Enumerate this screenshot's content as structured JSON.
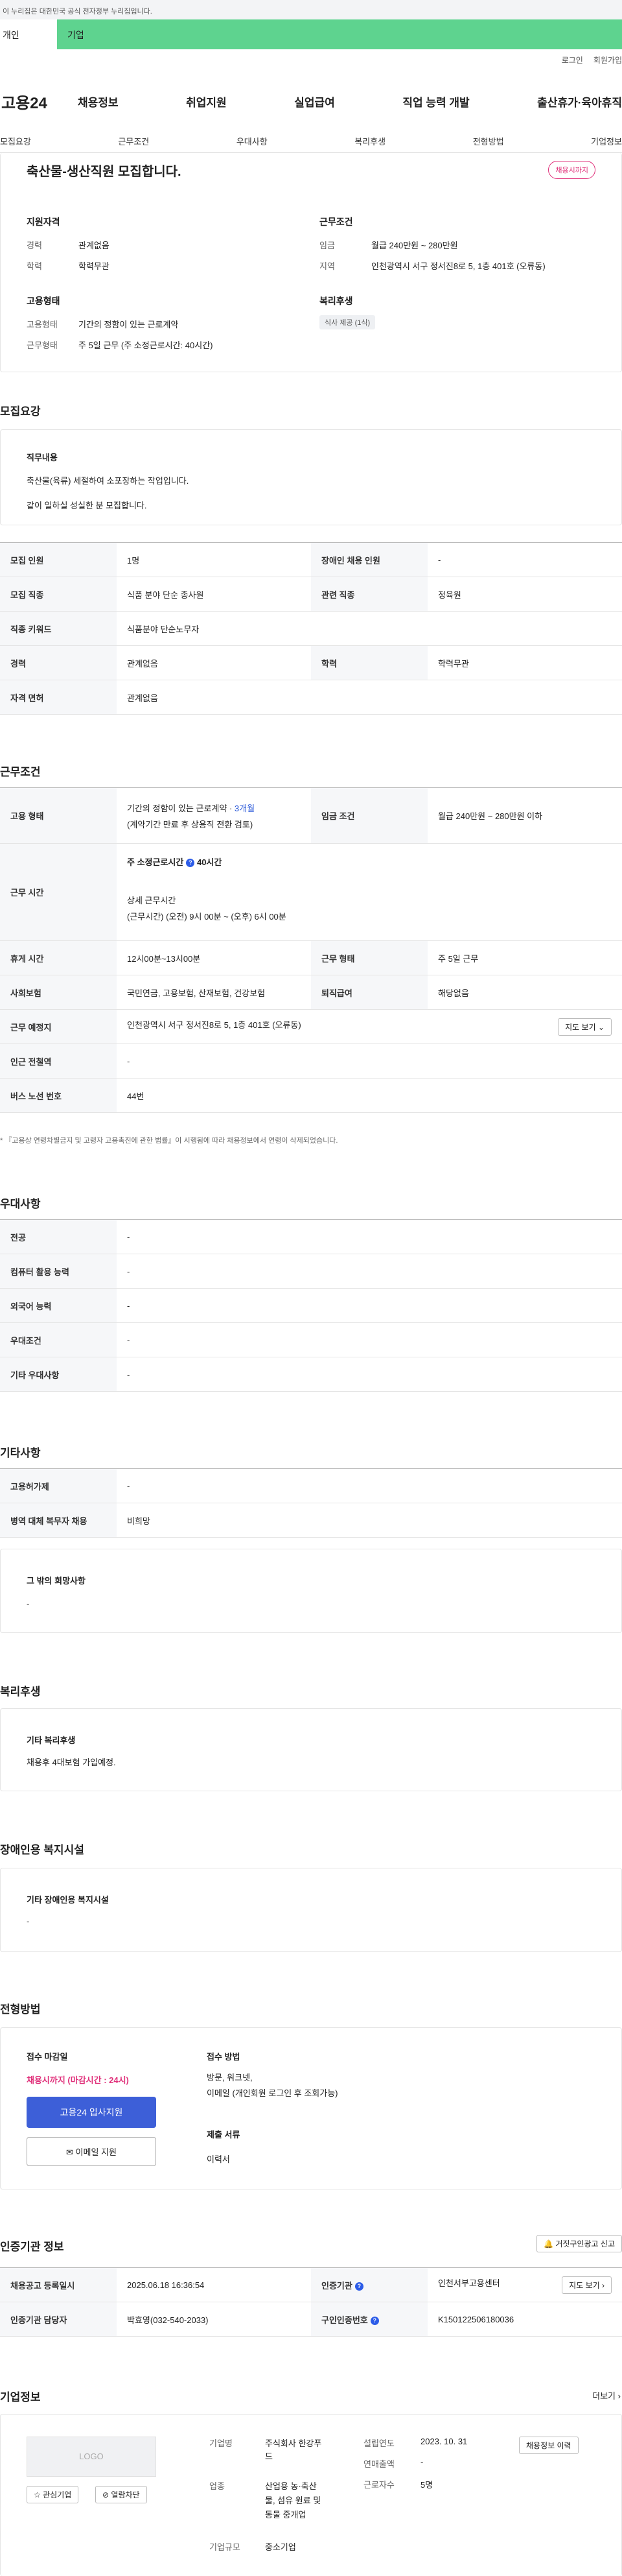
{
  "gov_banner": "이 누리집은 대한민국 공식 전자정부 누리집입니다.",
  "top_tabs": {
    "tab1": "개인",
    "tab2": "기업"
  },
  "top_links": {
    "login": "로그인",
    "join": "회원가입"
  },
  "logo": "고용24",
  "gnb": [
    "채용정보",
    "취업지원",
    "실업급여",
    "직업 능력 개발",
    "출산휴가·육아휴직"
  ],
  "subnav": [
    "모집요강",
    "근무조건",
    "우대사항",
    "복리후생",
    "전형방법",
    "기업정보"
  ],
  "job": {
    "title": "축산물-생산직원 모집합니다.",
    "badge": "채용시까지",
    "qualification_title": "지원자격",
    "career_label": "경력",
    "career_value": "관계없음",
    "edu_label": "학력",
    "edu_value": "학력무관",
    "work_title": "근무조건",
    "wage_label": "임금",
    "wage_value": "월급 240만원 ~ 280만원",
    "region_label": "지역",
    "region_value": "인천광역시 서구 정서진8로 5, 1층 401호 (오류동)",
    "emp_title": "고용형태",
    "emp_label": "고용형태",
    "emp_value": "기간의 정함이 있는 근로계약",
    "shift_label": "근무형태",
    "shift_value": "주 5일 근무 (주 소정근로시간: 40시간)",
    "welfare_title": "복리후생",
    "welfare_tag": "식사 제공 (1식)"
  },
  "recruit": {
    "section": "모집요강",
    "duty_title": "직무내용",
    "duty_line1": "축산물(육류) 세절하여 소포장하는 작업입니다.",
    "duty_line2": "같이 일하실 성실한 분  모집합니다.",
    "rows": [
      {
        "k1": "모집 인원",
        "v1": "1명",
        "k2": "장애인 채용 인원",
        "v2": "-"
      },
      {
        "k1": "모집 직종",
        "v1": "식품 분야 단순 종사원",
        "k2": "관련 직종",
        "v2": "정육원"
      },
      {
        "k1": "직종 키워드",
        "v1": "식품분야 단순노무자"
      },
      {
        "k1": "경력",
        "v1": "관계없음",
        "k2": "학력",
        "v2": "학력무관"
      },
      {
        "k1": "자격 면허",
        "v1": "관계없음"
      }
    ]
  },
  "cond": {
    "section": "근무조건",
    "emp_k": "고용 형태",
    "emp_v1": "기간의 정함이 있는 근로계약 · ",
    "emp_v1b": "3개월",
    "emp_v2": "(계약기간 만료 후 상용직 전환 검토)",
    "wage_k": "임금 조건",
    "wage_v": "월급 240만원 ~ 280만원 이하",
    "time_k": "근무 시간",
    "time_v1": "주 소정근로시간",
    "time_v1b": "40시간",
    "time_v2": "상세 근무시간",
    "time_v3": "(근무시간) (오전) 9시 00분 ~ (오후) 6시 00분",
    "rest_k": "휴게 시간",
    "rest_v": "12시00분~13시00분",
    "shift_k": "근무 형태",
    "shift_v": "주 5일 근무",
    "ins_k": "사회보험",
    "ins_v": "국민연금, 고용보험, 산재보험, 건강보험",
    "sev_k": "퇴직급여",
    "sev_v": "해당없음",
    "place_k": "근무 예정지",
    "place_v": "인천광역시 서구 정서진8로 5, 1층 401호 (오류동)",
    "map_btn": "지도 보기",
    "subway_k": "인근 전철역",
    "subway_v": "-",
    "bus_k": "버스 노선 번호",
    "bus_v": "44번",
    "note": "* 『고용상 연령차별금지 및 고령자 고용촉진에 관한 법률』이 시행됨에 따라 채용정보에서 연령이 삭제되었습니다."
  },
  "pref": {
    "section": "우대사항",
    "rows": [
      {
        "k": "전공",
        "v": "-"
      },
      {
        "k": "컴퓨터 활용 능력",
        "v": "-"
      },
      {
        "k": "외국어 능력",
        "v": "-"
      },
      {
        "k": "우대조건",
        "v": "-"
      },
      {
        "k": "기타 우대사항",
        "v": "-"
      }
    ]
  },
  "etc": {
    "section": "기타사항",
    "rows": [
      {
        "k": "고용허가제",
        "v": "-"
      },
      {
        "k": "병역 대체 복무자 채용",
        "v": "비희망"
      }
    ],
    "box_title": "그 밖의 희망사항",
    "box_value": "-"
  },
  "welfare": {
    "section": "복리후생",
    "box_title": "기타 복리후생",
    "box_value": "채용후 4대보험 가입예정."
  },
  "disabled": {
    "section": "장애인용 복지시설",
    "box_title": "기타 장애인용 복지시설",
    "box_value": "-"
  },
  "process": {
    "section": "전형방법",
    "deadline_label": "접수 마감일",
    "deadline_value": "채용시까지 (마감시간 : 24시)",
    "apply_btn": "고용24 입사지원",
    "email_btn": "이메일 지원",
    "method_label": "접수 방법",
    "method_value1": "방문, 워크넷,",
    "method_value2": "이메일 (개인회원 로그인 후 조회가능)",
    "docs_label": "제출 서류",
    "docs_value": "이력서"
  },
  "cert": {
    "section": "인증기관 정보",
    "report_btn": "거짓구인광고 신고",
    "reg_k": "채용공고 등록일시",
    "reg_v": "2025.06.18 16:36:54",
    "org_k": "인증기관",
    "org_v": "인천서부고용센터",
    "map_btn": "지도 보기",
    "mgr_k": "인증기관 담당자",
    "mgr_v": "박효영(032-540-2033)",
    "id_k": "구인인증번호",
    "id_v": "K150122506180036"
  },
  "company": {
    "section": "기업정보",
    "more": "더보기",
    "logo": "LOGO",
    "fav_btn": "관심기업",
    "block_btn": "열람차단",
    "name_k": "기업명",
    "name_v1": "주식회사 한강푸",
    "name_v2": "드",
    "ind_k": "업종",
    "ind_v1": "산업용 농·축산",
    "ind_v2": "물, 섬유 원료 및",
    "ind_v3": "동물 중개업",
    "size_k": "기업규모",
    "size_v": "중소기업",
    "found_k": "설립연도",
    "found_v": "2023. 10. 31",
    "sales_k": "연매출액",
    "sales_v": "-",
    "emp_k": "근로자수",
    "emp_v": "5명",
    "history_btn": "채용정보 이력"
  }
}
